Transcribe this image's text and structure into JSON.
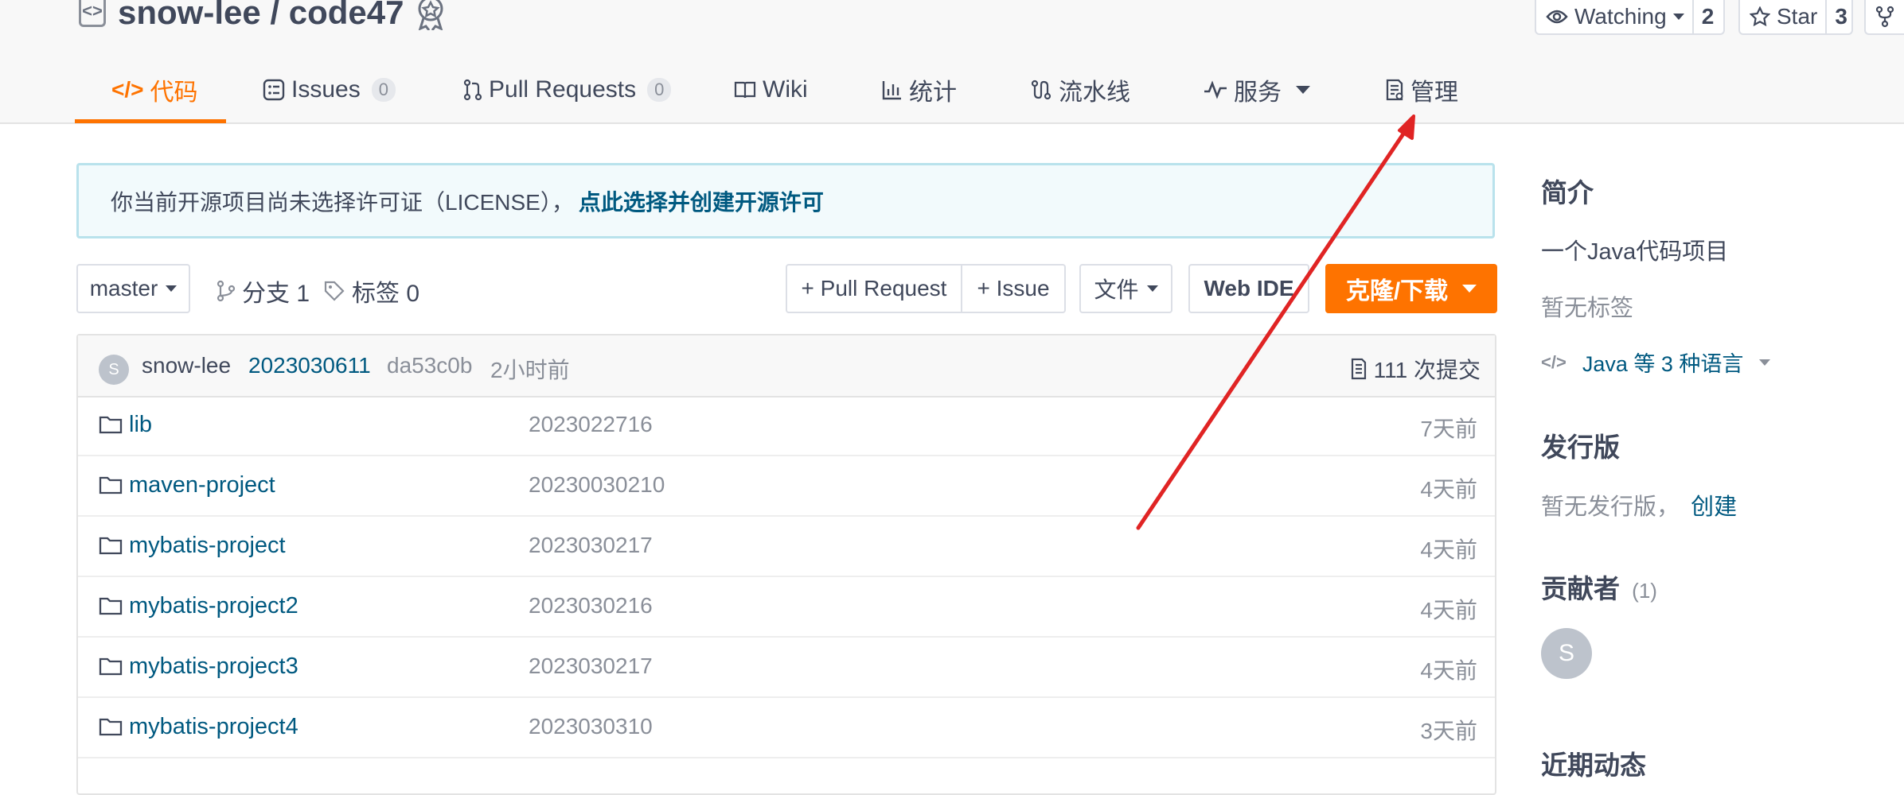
{
  "repo": {
    "title": "snow-lee / code47"
  },
  "header_buttons": {
    "watch": {
      "label": "Watching",
      "count": "2"
    },
    "star": {
      "label": "Star",
      "count": "3"
    }
  },
  "tabs": [
    {
      "label": "代码",
      "active": true
    },
    {
      "label": "Issues",
      "count": "0"
    },
    {
      "label": "Pull Requests",
      "count": "0"
    },
    {
      "label": "Wiki"
    },
    {
      "label": "统计"
    },
    {
      "label": "流水线"
    },
    {
      "label": "服务"
    },
    {
      "label": "管理"
    }
  ],
  "notice": {
    "text": "你当前开源项目尚未选择许可证（LICENSE），",
    "link": "点此选择并创建开源许可"
  },
  "toolbar": {
    "branch": "master",
    "branches": "分支 1",
    "tags": "标签 0",
    "pull_request": "+ Pull Request",
    "issue": "+ Issue",
    "files": "文件",
    "web_ide": "Web IDE",
    "clone": "克隆/下载"
  },
  "commit": {
    "avatar": "S",
    "author": "snow-lee",
    "message": "2023030611",
    "sha": "da53c0b",
    "time": "2小时前",
    "count": "111 次提交"
  },
  "files": [
    {
      "name": "lib",
      "message": "2023022716",
      "time": "7天前"
    },
    {
      "name": "maven-project",
      "message": "20230030210",
      "time": "4天前"
    },
    {
      "name": "mybatis-project",
      "message": "2023030217",
      "time": "4天前"
    },
    {
      "name": "mybatis-project2",
      "message": "2023030216",
      "time": "4天前"
    },
    {
      "name": "mybatis-project3",
      "message": "2023030217",
      "time": "4天前"
    },
    {
      "name": "mybatis-project4",
      "message": "2023030310",
      "time": "3天前"
    }
  ],
  "sidebar": {
    "intro_heading": "简介",
    "intro_text": "一个Java代码项目",
    "no_tags": "暂无标签",
    "language": "Java 等 3 种语言",
    "releases_heading": "发行版",
    "no_releases": "暂无发行版，",
    "create_link": "创建",
    "contributors_heading": "贡献者",
    "contributors_count": "(1)",
    "contributor_avatar": "S",
    "activity_heading": "近期动态"
  },
  "colors": {
    "accent": "#fe7300",
    "link": "#005980",
    "annotation_arrow": "#e02424"
  }
}
